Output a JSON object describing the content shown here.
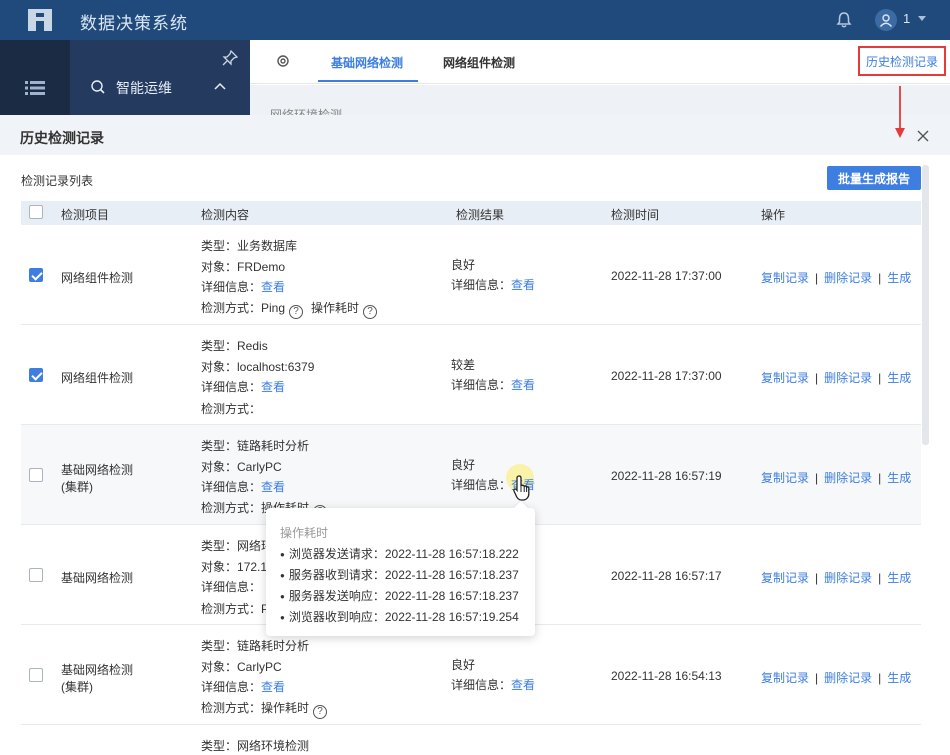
{
  "app": {
    "title": "数据决策系统",
    "user_name": "1"
  },
  "nav": {
    "section_label": "智能运维"
  },
  "tabs": [
    {
      "label": "基础网络检测"
    },
    {
      "label": "网络组件检测"
    }
  ],
  "history_button": "历史检测记录",
  "background_label": "网络环境检测",
  "dialog": {
    "title": "历史检测记录",
    "list_title": "检测记录列表",
    "batch_button": "批量生成报告",
    "columns": [
      "检测项目",
      "检测内容",
      "检测结果",
      "检测时间",
      "操作"
    ],
    "labels": {
      "type": "类型：",
      "target": "对象：",
      "detail": "详细信息：",
      "method": "检测方式：",
      "view": "查看",
      "op_time": "操作耗时",
      "q": "?"
    },
    "actions": {
      "copy": "复制记录",
      "delete": "删除记录",
      "generate": "生成",
      "sep": "|"
    },
    "rows": [
      {
        "checked": true,
        "item": "网络组件检测",
        "item2": "",
        "type": "业务数据库",
        "target": "FRDemo",
        "method": "Ping",
        "has_optime": true,
        "result": "良好",
        "time": "2022-11-28 17:37:00"
      },
      {
        "checked": true,
        "item": "网络组件检测",
        "item2": "",
        "type": "Redis",
        "target": "localhost:6379",
        "method": "",
        "has_optime": false,
        "result": "较差",
        "time": "2022-11-28 17:37:00"
      },
      {
        "checked": false,
        "item": "基础网络检测",
        "item2": "(集群)",
        "type": "链路耗时分析",
        "target": "CarlyPC",
        "method": "",
        "has_optime": true,
        "result": "良好",
        "time": "2022-11-28 16:57:19"
      },
      {
        "checked": false,
        "item": "基础网络检测",
        "item2": "",
        "type": "网络环",
        "target": "172.1",
        "method": "P",
        "has_optime": false,
        "result": "",
        "time": "2022-11-28 16:57:17"
      },
      {
        "checked": false,
        "item": "基础网络检测",
        "item2": "(集群)",
        "type": "链路耗时分析",
        "target": "CarlyPC",
        "method": "",
        "has_optime": true,
        "result": "良好",
        "time": "2022-11-28 16:54:13"
      },
      {
        "type": "网络环境检测"
      }
    ]
  },
  "tooltip": {
    "title": "操作耗时",
    "lines": [
      "浏览器发送请求：2022-11-28 16:57:18.222",
      "服务器收到请求：2022-11-28 16:57:18.237",
      "服务器发送响应：2022-11-28 16:57:18.237",
      "浏览器收到响应：2022-11-28 16:57:19.254"
    ]
  },
  "colors": {
    "accent": "#3d7ee0",
    "topbar": "#1f4a7b",
    "highlight_red": "#e53a3a"
  }
}
